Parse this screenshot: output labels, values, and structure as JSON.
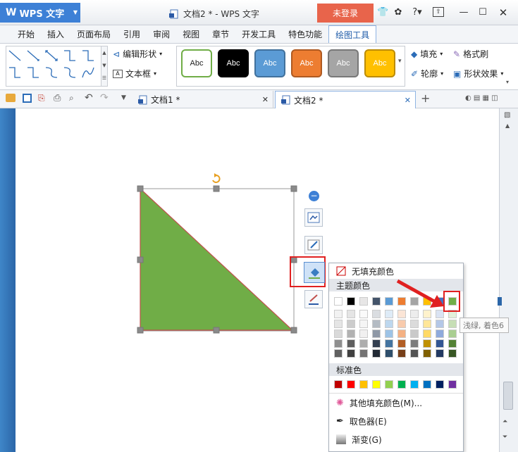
{
  "app": {
    "name": "WPS 文字",
    "title": "文档2 * - WPS 文字",
    "login": "未登录"
  },
  "tabs": [
    "开始",
    "插入",
    "页面布局",
    "引用",
    "审阅",
    "视图",
    "章节",
    "开发工具",
    "特色功能",
    "绘图工具"
  ],
  "ribbon": {
    "edit_shape": "编辑形状",
    "textbox": "文本框",
    "style_label": "Abc",
    "fill": "填充",
    "format_painter": "格式刷",
    "outline": "轮廓",
    "shape_effect": "形状效果"
  },
  "doc_tabs": [
    "文档1 *",
    "文档2 *"
  ],
  "shape_styles": [
    {
      "bg": "#ffffff",
      "border": "#70ad47",
      "fg": "#222222"
    },
    {
      "bg": "#000000",
      "border": "#000000",
      "fg": "#ffffff"
    },
    {
      "bg": "#5b9bd5",
      "border": "#41719c",
      "fg": "#ffffff"
    },
    {
      "bg": "#ed7d31",
      "border": "#ae5a21",
      "fg": "#ffffff"
    },
    {
      "bg": "#a5a5a5",
      "border": "#787878",
      "fg": "#ffffff"
    },
    {
      "bg": "#ffc000",
      "border": "#bc8c00",
      "fg": "#ffffff"
    }
  ],
  "shape": {
    "fill": "#70ad47",
    "stroke": "#c0504d"
  },
  "fill_popup": {
    "no_fill": "无填充颜色",
    "theme_colors_title": "主题颜色",
    "theme_colors": [
      "#ffffff",
      "#000000",
      "#e7e6e6",
      "#44546a",
      "#5b9bd5",
      "#ed7d31",
      "#a5a5a5",
      "#ffc000",
      "#4472c4",
      "#70ad47"
    ],
    "standard_title": "标准色",
    "standard_colors": [
      "#c00000",
      "#ff0000",
      "#ffc000",
      "#ffff00",
      "#92d050",
      "#00b050",
      "#00b0f0",
      "#0070c0",
      "#002060",
      "#7030a0"
    ],
    "more_colors": "其他填充颜色(M)...",
    "picker": "取色器(E)",
    "gradient": "渐变(G)",
    "tooltip": "浅绿, 着色6"
  }
}
